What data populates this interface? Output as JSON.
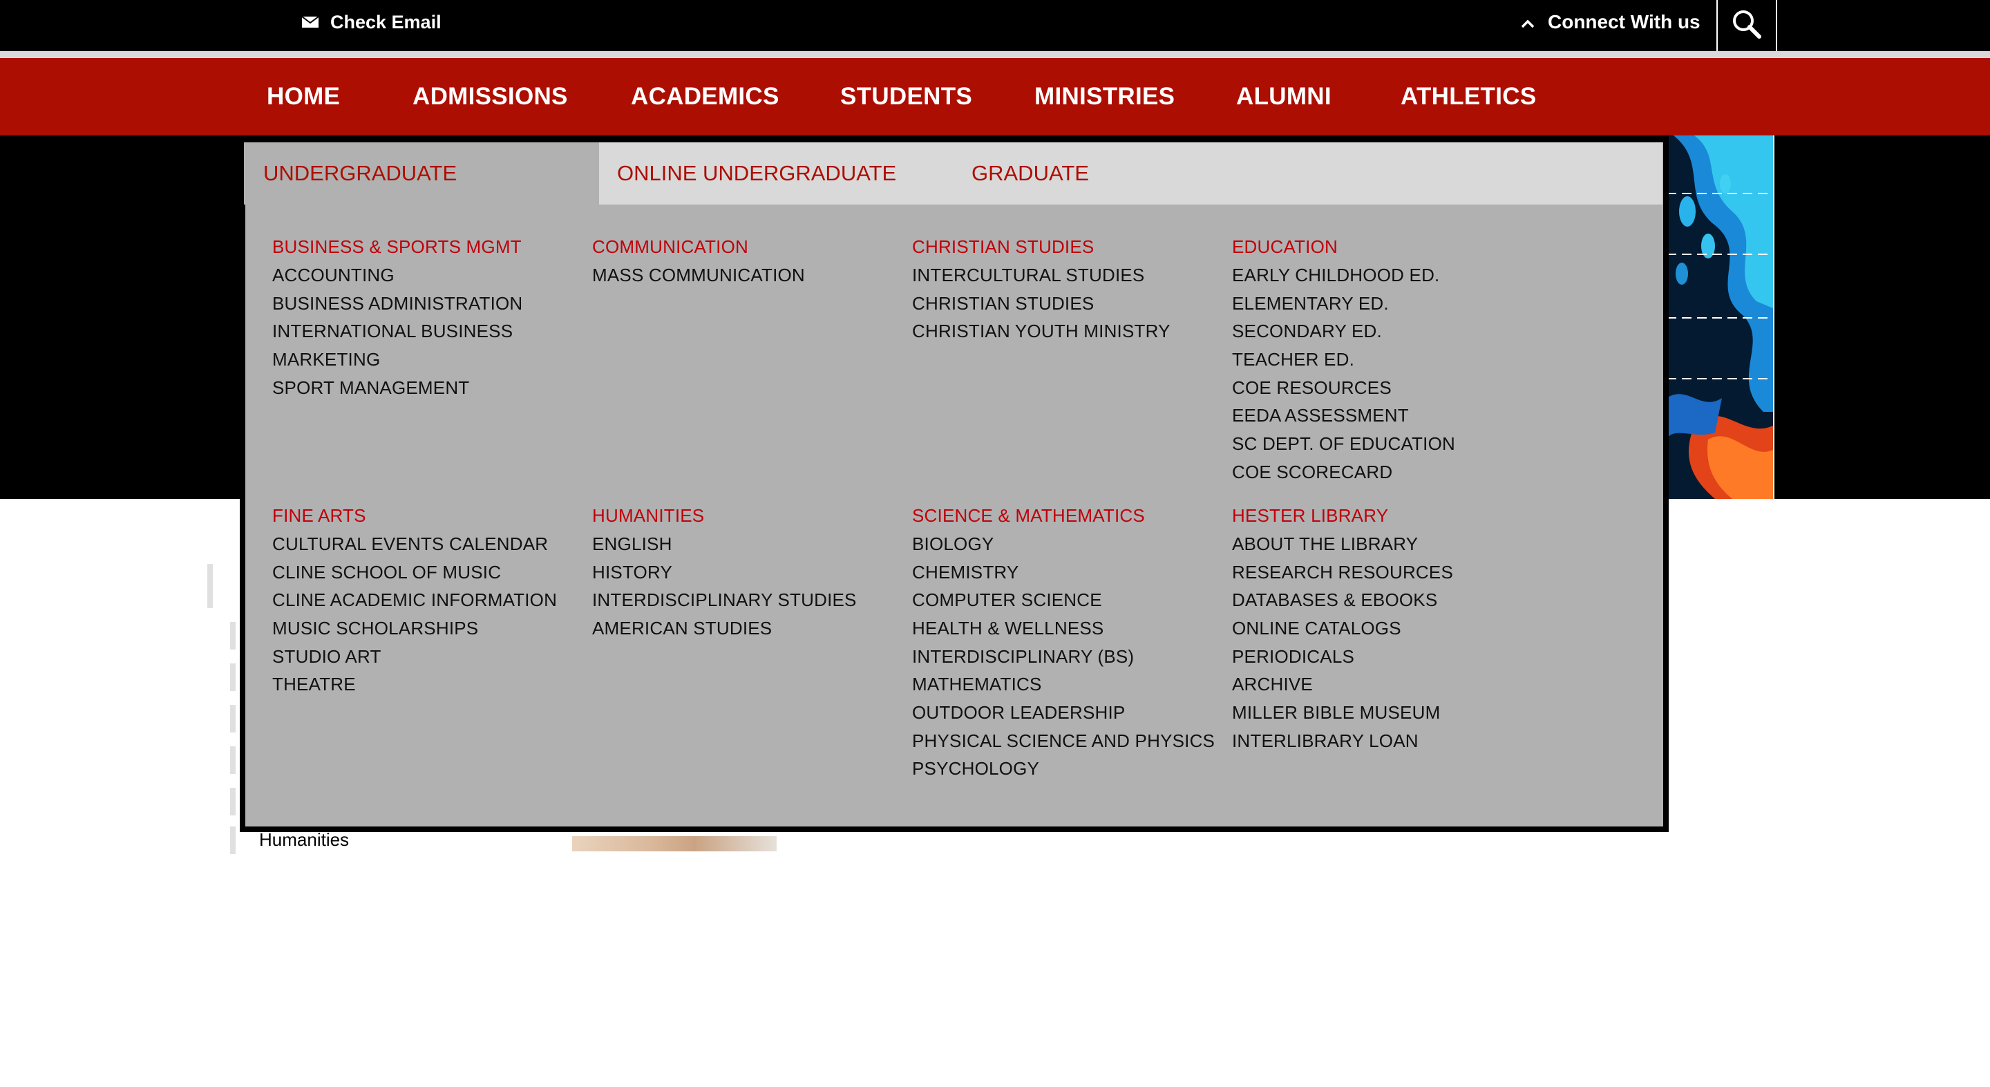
{
  "topbar": {
    "check_email": "Check Email",
    "connect": "Connect With us",
    "icons": [
      "mail-icon",
      "chevron-up-icon",
      "search-icon"
    ]
  },
  "nav": {
    "items": [
      "HOME",
      "ADMISSIONS",
      "ACADEMICS",
      "STUDENTS",
      "MINISTRIES",
      "ALUMNI",
      "ATHLETICS"
    ]
  },
  "mega": {
    "tabs": [
      "UNDERGRADUATE",
      "ONLINE UNDERGRADUATE",
      "GRADUATE"
    ],
    "active_tab": "UNDERGRADUATE",
    "columns": [
      {
        "heading": "BUSINESS & SPORTS MGMT",
        "links": [
          "ACCOUNTING",
          "BUSINESS ADMINISTRATION",
          "INTERNATIONAL BUSINESS",
          "MARKETING",
          "SPORT MANAGEMENT"
        ]
      },
      {
        "heading": "COMMUNICATION",
        "links": [
          "MASS COMMUNICATION"
        ]
      },
      {
        "heading": "CHRISTIAN STUDIES",
        "links": [
          "INTERCULTURAL STUDIES",
          "CHRISTIAN STUDIES",
          "CHRISTIAN YOUTH MINISTRY"
        ]
      },
      {
        "heading": "EDUCATION",
        "links": [
          "EARLY CHILDHOOD ED.",
          "ELEMENTARY ED.",
          "SECONDARY ED.",
          "TEACHER ED.",
          "COE RESOURCES",
          "EEDA ASSESSMENT",
          "SC DEPT. OF EDUCATION",
          "COE SCORECARD"
        ]
      },
      {
        "heading": "FINE ARTS",
        "links": [
          "CULTURAL EVENTS CALENDAR",
          "CLINE SCHOOL OF MUSIC",
          "CLINE ACADEMIC INFORMATION",
          "MUSIC SCHOLARSHIPS",
          "STUDIO ART",
          "THEATRE"
        ]
      },
      {
        "heading": "HUMANITIES",
        "links": [
          "ENGLISH",
          "HISTORY",
          "INTERDISCIPLINARY STUDIES",
          "AMERICAN STUDIES"
        ]
      },
      {
        "heading": "SCIENCE & MATHEMATICS",
        "links": [
          "BIOLOGY",
          "CHEMISTRY",
          "COMPUTER SCIENCE",
          "HEALTH & WELLNESS",
          "INTERDISCIPLINARY (BS)",
          "MATHEMATICS",
          "OUTDOOR LEADERSHIP",
          "PHYSICAL SCIENCE AND PHYSICS",
          "PSYCHOLOGY"
        ]
      },
      {
        "heading": "HESTER LIBRARY",
        "links": [
          "ABOUT THE LIBRARY",
          "RESEARCH RESOURCES",
          "DATABASES & EBOOKS",
          "ONLINE CATALOGS",
          "PERIODICALS",
          "ARCHIVE",
          "MILLER BIBLE MUSEUM",
          "INTERLIBRARY LOAN"
        ]
      }
    ]
  },
  "page": {
    "sidebar_visible_item": "Humanities"
  },
  "colors": {
    "brand_red": "#ad0e02",
    "menu_bg": "#b1b1b1",
    "tab_bar_bg": "#d9d9d9",
    "heading_red": "#c0000a"
  }
}
